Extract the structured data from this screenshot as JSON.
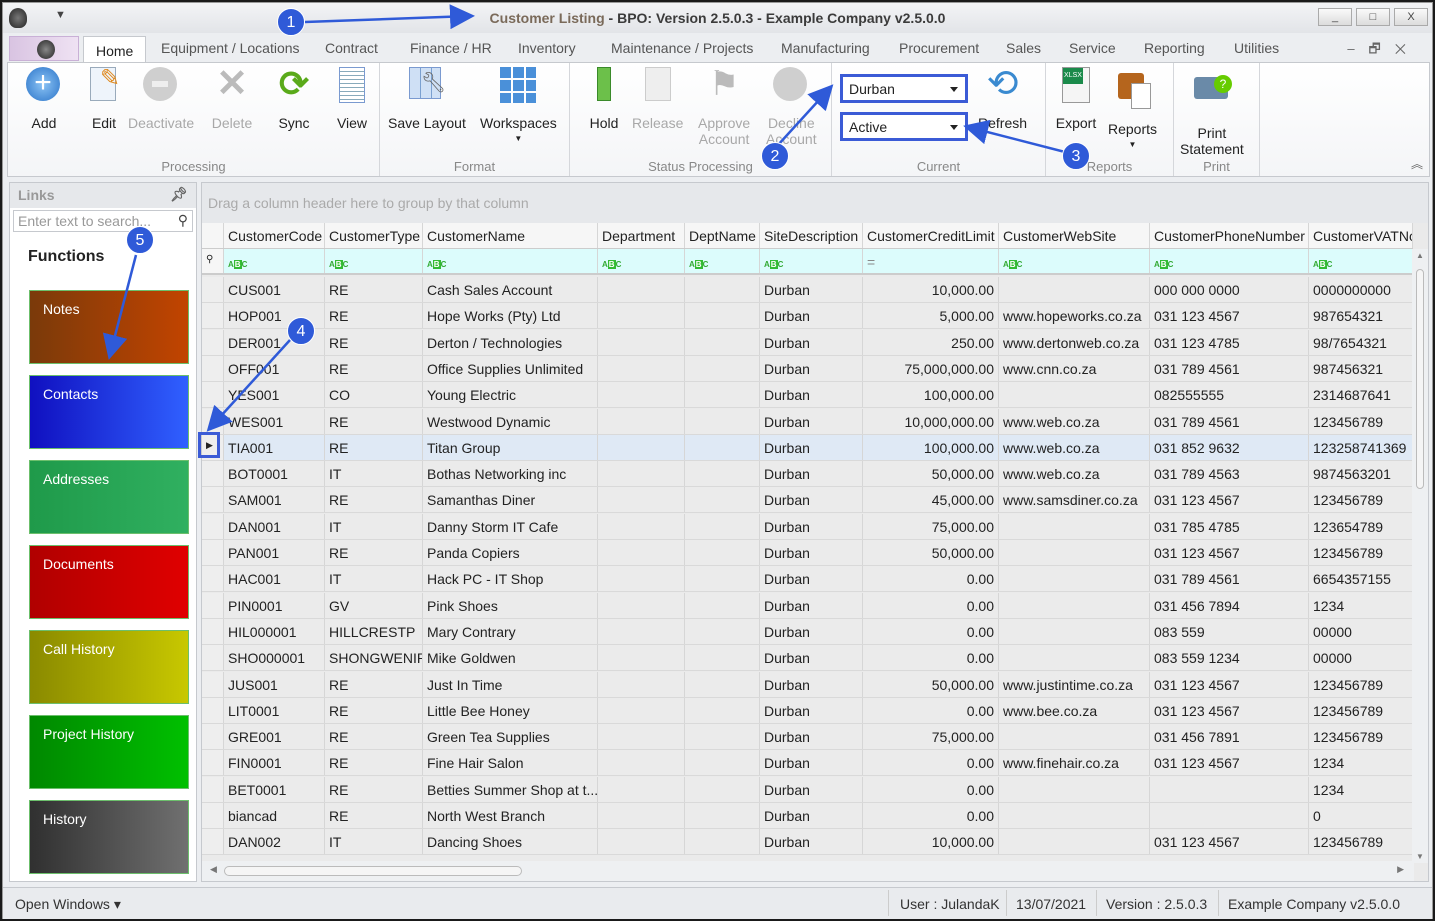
{
  "window": {
    "title_part1": "Customer Listing",
    "title_part2": " - BPO: Version 2.5.0.3 - Example Company v2.5.0.0",
    "minimize": "_",
    "maximize": "□",
    "close": "X"
  },
  "tabs": [
    "Home",
    "Equipment / Locations",
    "Contract",
    "Finance / HR",
    "Inventory",
    "Maintenance / Projects",
    "Manufacturing",
    "Procurement",
    "Sales",
    "Service",
    "Reporting",
    "Utilities"
  ],
  "ribbon": {
    "groups": {
      "processing": "Processing",
      "format": "Format",
      "status": "Status Processing",
      "current": "Current",
      "reports": "Reports",
      "print": "Print"
    },
    "buttons": {
      "add": "Add",
      "edit": "Edit",
      "deactivate": "Deactivate",
      "delete": "Delete",
      "sync": "Sync",
      "view": "View",
      "save_layout": "Save Layout",
      "workspaces": "Workspaces",
      "hold": "Hold",
      "release": "Release",
      "approve": "Approve\nAccount",
      "decline": "Decline\nAccount",
      "refresh": "Refresh",
      "export": "Export",
      "reports": "Reports",
      "print_statement": "Print\nStatement"
    },
    "site_combo": "Durban",
    "status_combo": "Active",
    "xlsx": "XLSX"
  },
  "links": {
    "title": "Links",
    "search_placeholder": "Enter text to search...",
    "functions": "Functions",
    "tiles": [
      {
        "label": "Notes",
        "from": "#7a3a0a",
        "to": "#c24400"
      },
      {
        "label": "Contacts",
        "from": "#1010c0",
        "to": "#3060ff"
      },
      {
        "label": "Addresses",
        "from": "#1f9a4a",
        "to": "#30b060"
      },
      {
        "label": "Documents",
        "from": "#b00000",
        "to": "#e00000"
      },
      {
        "label": "Call History",
        "from": "#8a8a00",
        "to": "#c8c800"
      },
      {
        "label": "Project History",
        "from": "#008800",
        "to": "#00c000"
      },
      {
        "label": "History",
        "from": "#303030",
        "to": "#707070"
      }
    ]
  },
  "grid": {
    "group_hint": "Drag a column header here to group by that column",
    "columns": [
      "CustomerCode",
      "CustomerType",
      "CustomerName",
      "Department",
      "DeptName",
      "SiteDescription",
      "CustomerCreditLimit",
      "CustomerWebSite",
      "CustomerPhoneNumber",
      "CustomerVATNo"
    ],
    "selected_row": 6,
    "rows": [
      [
        "CUS001",
        "RE",
        "Cash Sales Account",
        "",
        "",
        "Durban",
        "10,000.00",
        "",
        "000 000 0000",
        "0000000000"
      ],
      [
        "HOP001",
        "RE",
        "Hope Works (Pty) Ltd",
        "",
        "",
        "Durban",
        "5,000.00",
        "www.hopeworks.co.za",
        "031 123 4567",
        "987654321"
      ],
      [
        "DER001",
        "RE",
        "Derton / Technologies",
        "",
        "",
        "Durban",
        "250.00",
        "www.dertonweb.co.za",
        "031 123 4785",
        "98/7654321"
      ],
      [
        "OFF001",
        "RE",
        "Office Supplies Unlimited",
        "",
        "",
        "Durban",
        "75,000,000.00",
        "www.cnn.co.za",
        "031 789 4561",
        "987456321"
      ],
      [
        "YES001",
        "CO",
        "Young Electric",
        "",
        "",
        "Durban",
        "100,000.00",
        "",
        "082555555",
        "2314687641"
      ],
      [
        "WES001",
        "RE",
        "Westwood Dynamic",
        "",
        "",
        "Durban",
        "10,000,000.00",
        "www.web.co.za",
        "031 789 4561",
        "123456789"
      ],
      [
        "TIA001",
        "RE",
        "Titan Group",
        "",
        "",
        "Durban",
        "100,000.00",
        "www.web.co.za",
        "031 852 9632",
        "123258741369"
      ],
      [
        "BOT0001",
        "IT",
        "Bothas Networking inc",
        "",
        "",
        "Durban",
        "50,000.00",
        "www.web.co.za",
        "031 789 4563",
        "9874563201"
      ],
      [
        "SAM001",
        "RE",
        "Samanthas Diner",
        "",
        "",
        "Durban",
        "45,000.00",
        "www.samsdiner.co.za",
        "031 123 4567",
        "123456789"
      ],
      [
        "DAN001",
        "IT",
        "Danny Storm IT Cafe",
        "",
        "",
        "Durban",
        "75,000.00",
        "",
        "031 785 4785",
        "123654789"
      ],
      [
        "PAN001",
        "RE",
        "Panda Copiers",
        "",
        "",
        "Durban",
        "50,000.00",
        "",
        "031 123 4567",
        "123456789"
      ],
      [
        "HAC001",
        "IT",
        "Hack PC - IT Shop",
        "",
        "",
        "Durban",
        "0.00",
        "",
        "031 789 4561",
        "6654357155"
      ],
      [
        "PIN0001",
        "GV",
        "Pink Shoes",
        "",
        "",
        "Durban",
        "0.00",
        "",
        "031 456 7894",
        "1234"
      ],
      [
        "HIL000001",
        "HILLCRESTP",
        "Mary Contrary",
        "",
        "",
        "Durban",
        "0.00",
        "",
        "083 559",
        "00000"
      ],
      [
        "SHO000001",
        "SHONGWENIP",
        "Mike Goldwen",
        "",
        "",
        "Durban",
        "0.00",
        "",
        "083 559 1234",
        "00000"
      ],
      [
        "JUS001",
        "RE",
        "Just In Time",
        "",
        "",
        "Durban",
        "50,000.00",
        "www.justintime.co.za",
        "031 123 4567",
        "123456789"
      ],
      [
        "LIT0001",
        "RE",
        "Little Bee Honey",
        "",
        "",
        "Durban",
        "0.00",
        "www.bee.co.za",
        "031 123 4567",
        "123456789"
      ],
      [
        "GRE001",
        "RE",
        "Green Tea Supplies",
        "",
        "",
        "Durban",
        "75,000.00",
        "",
        "031 456 7891",
        "123456789"
      ],
      [
        "FIN0001",
        "RE",
        "Fine Hair Salon",
        "",
        "",
        "Durban",
        "0.00",
        "www.finehair.co.za",
        "031 123 4567",
        "1234"
      ],
      [
        "BET0001",
        "RE",
        "Betties Summer Shop at t...",
        "",
        "",
        "Durban",
        "0.00",
        "",
        "",
        "1234"
      ],
      [
        "biancad",
        "RE",
        "North West Branch",
        "",
        "",
        "Durban",
        "0.00",
        "",
        "",
        "0"
      ],
      [
        "DAN002",
        "IT",
        "Dancing Shoes",
        "",
        "",
        "Durban",
        "10,000.00",
        "",
        "031 123 4567",
        "123456789"
      ]
    ]
  },
  "status": {
    "open_windows": "Open Windows ▾",
    "user": "User : JulandaK",
    "date": "13/07/2021",
    "version": "Version : 2.5.0.3",
    "company": "Example Company v2.5.0.0"
  },
  "annotations": [
    "1",
    "2",
    "3",
    "4",
    "5"
  ],
  "accent": "#2f5ad8"
}
